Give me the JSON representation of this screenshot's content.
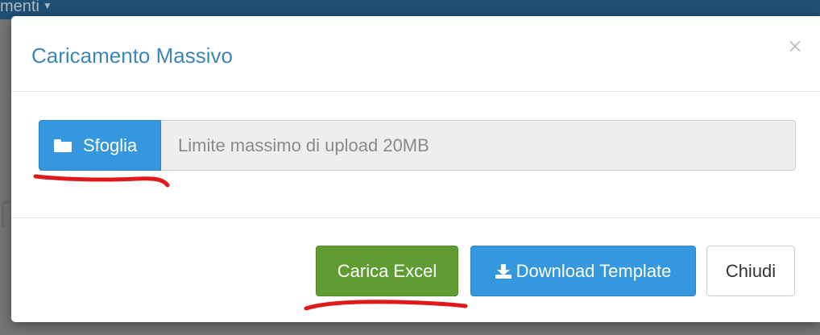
{
  "background": {
    "navbar_text": "menti"
  },
  "modal": {
    "title": "Caricamento Massivo",
    "close_symbol": "×",
    "browse_label": "Sfoglia",
    "upload_placeholder": "Limite massimo di upload 20MB",
    "footer": {
      "upload_excel_label": "Carica Excel",
      "download_template_label": "Download Template",
      "close_label": "Chiudi"
    }
  },
  "icons": {
    "browse": "folder-open-icon",
    "download": "download-icon",
    "navbar_caret": "caret-down-icon"
  },
  "colors": {
    "title": "#3a86b8",
    "primary": "#3597de",
    "success": "#5f9d33",
    "annotation": "#e01a1a",
    "navbar": "#1f4f73"
  }
}
